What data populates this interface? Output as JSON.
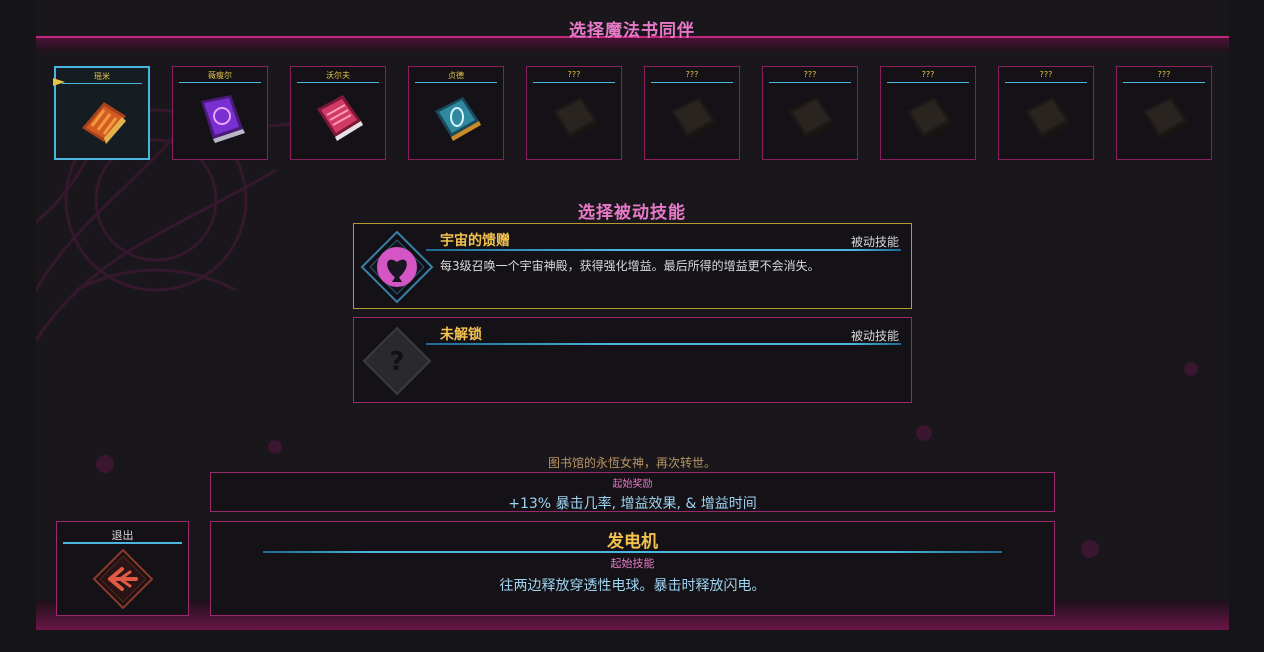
{
  "header": {
    "title": "选择魔法书同伴"
  },
  "books": [
    {
      "name": "瑶米",
      "state": "selected",
      "icon": "orange-spellbook-icon"
    },
    {
      "name": "薇瘦尔",
      "state": "unlocked",
      "icon": "purple-spellbook-icon"
    },
    {
      "name": "沃尔夫",
      "state": "unlocked",
      "icon": "pink-spellbook-icon"
    },
    {
      "name": "贞德",
      "state": "unlocked",
      "icon": "teal-spellbook-icon"
    },
    {
      "name": "???",
      "state": "locked",
      "icon": "locked-book-icon"
    },
    {
      "name": "???",
      "state": "locked",
      "icon": "locked-book-icon"
    },
    {
      "name": "???",
      "state": "locked",
      "icon": "locked-book-icon"
    },
    {
      "name": "???",
      "state": "locked",
      "icon": "locked-book-icon"
    },
    {
      "name": "???",
      "state": "locked",
      "icon": "locked-book-icon"
    },
    {
      "name": "???",
      "state": "locked",
      "icon": "locked-book-icon"
    }
  ],
  "passive": {
    "title": "选择被动技能",
    "skills": [
      {
        "name": "宇宙的馈赠",
        "type": "被动技能",
        "description": "每3级召唤一个宇宙神殿，获得强化增益。最后所得的增益更不会消失。",
        "icon": "heart-spade-icon"
      },
      {
        "name": "未解锁",
        "type": "被动技能",
        "description": "",
        "icon": "question-mark-icon"
      }
    ]
  },
  "character": {
    "lore": "图书馆的永恆女神，再次转世。",
    "bonus_label": "起始奖励",
    "bonus_value": "+13% 暴击几率, 增益效果, & 增益时间",
    "ability_name": "发电机",
    "ability_label": "起始技能",
    "ability_desc": "往两边释放穿透性电球。暴击时释放闪电。"
  },
  "exit": {
    "label": "退出",
    "icon": "exit-arrow-icon"
  },
  "colors": {
    "accent_pink": "#e879c8",
    "border_magenta": "#9a2a6b",
    "gold": "#f2c14e",
    "cyan": "#49b6e0",
    "text_blue": "#9fd3f0"
  }
}
